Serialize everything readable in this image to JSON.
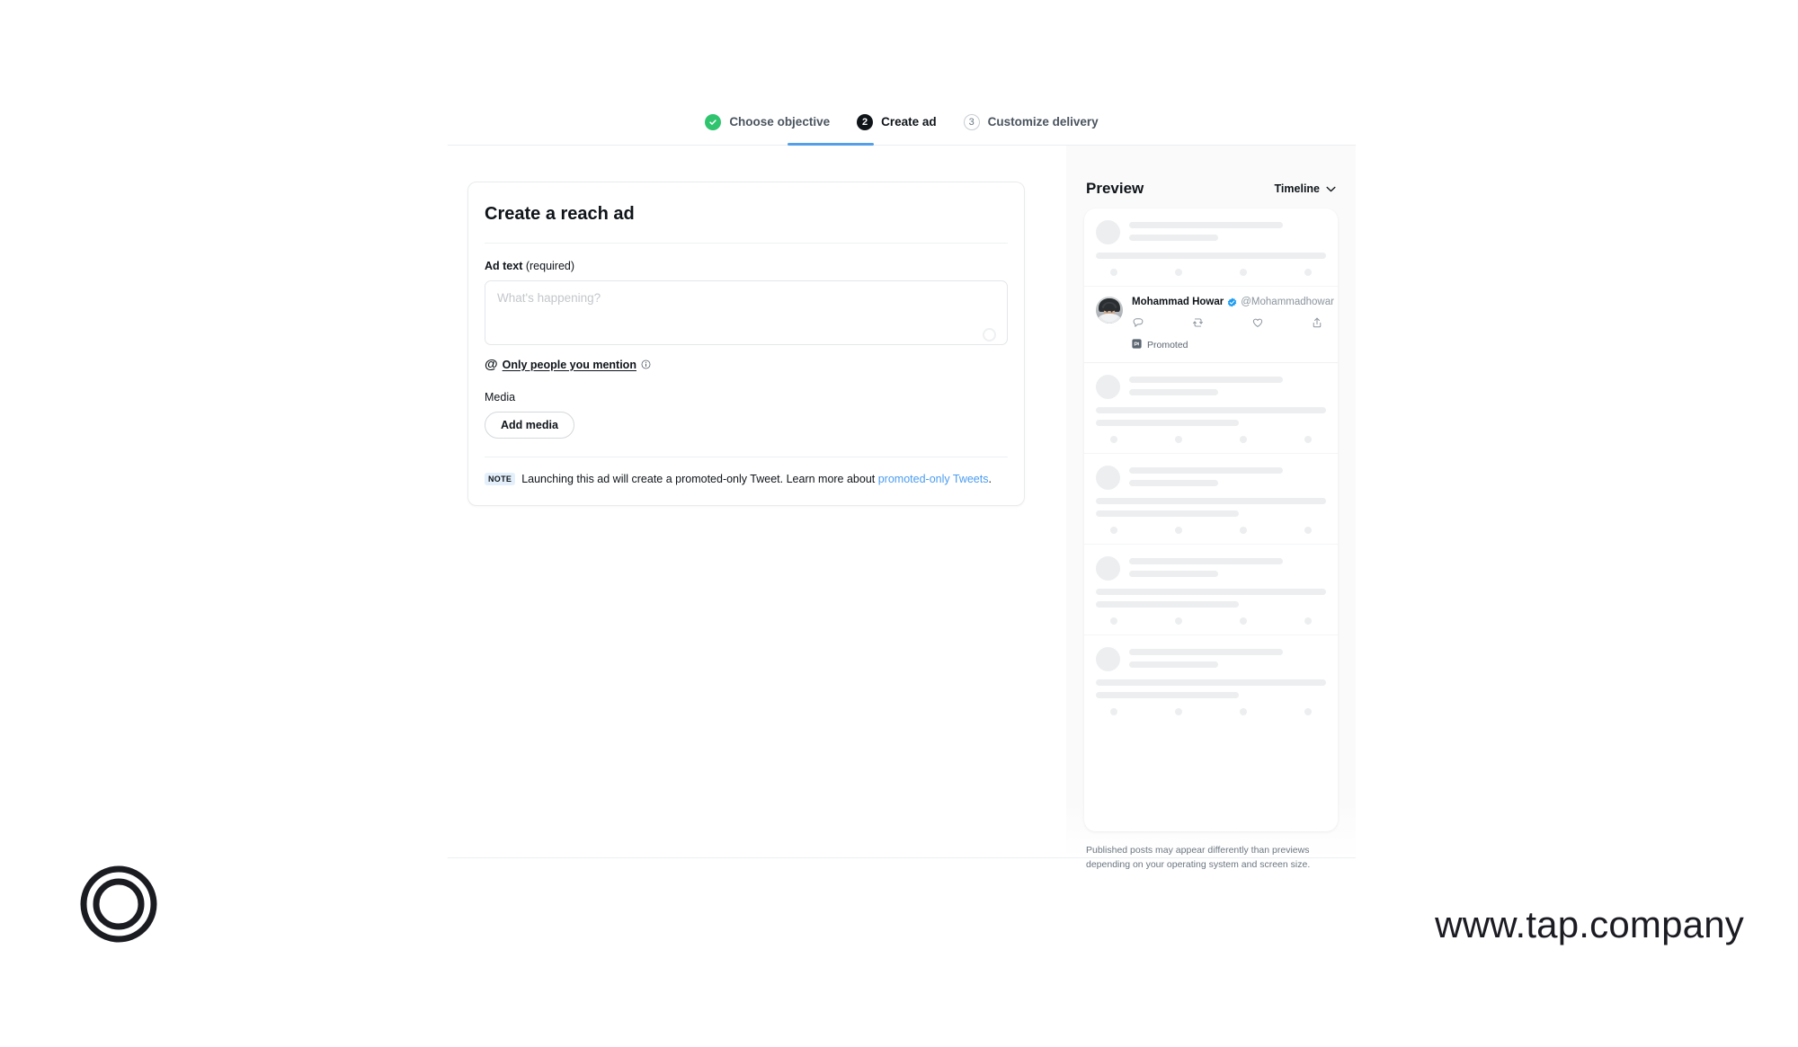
{
  "stepper": {
    "steps": [
      {
        "badge": "check-icon",
        "label": "Choose objective",
        "state": "done"
      },
      {
        "badge": "2",
        "label": "Create ad",
        "state": "active"
      },
      {
        "badge": "3",
        "label": "Customize delivery",
        "state": "idle"
      }
    ]
  },
  "form": {
    "title": "Create a reach ad",
    "ad_text": {
      "label_bold": "Ad text",
      "label_muted": " (required)",
      "placeholder": "What's happening?",
      "value": ""
    },
    "mention": {
      "at_symbol": "@",
      "text": "Only people you mention",
      "info_icon": "info-icon"
    },
    "media": {
      "label": "Media",
      "button": "Add media"
    },
    "note": {
      "badge": "NOTE",
      "text_before": "Launching this ad will create a promoted-only Tweet. Learn more about ",
      "link": "promoted-only Tweets",
      "text_after": "."
    }
  },
  "preview": {
    "title": "Preview",
    "select_value": "Timeline",
    "tweet": {
      "name": "Mohammad Howar",
      "handle": "@Mohammadhowar",
      "verified": true,
      "promoted_label": "Promoted",
      "actions": [
        "reply-icon",
        "retweet-icon",
        "like-icon",
        "share-icon"
      ]
    },
    "disclaimer": "Published posts may appear differently than previews depending on your operating system and screen size.",
    "skeleton_rows": 5
  },
  "footer": {
    "logo": "tap-logo",
    "url": "www.tap.company"
  },
  "colors": {
    "accent_blue": "#549fe8",
    "link_blue": "#4a9cf0",
    "success_green": "#30c46f",
    "verified_blue": "#1d9bf0",
    "text_primary": "#0f1419",
    "text_muted": "#6b7680",
    "skeleton": "#eceef0"
  }
}
